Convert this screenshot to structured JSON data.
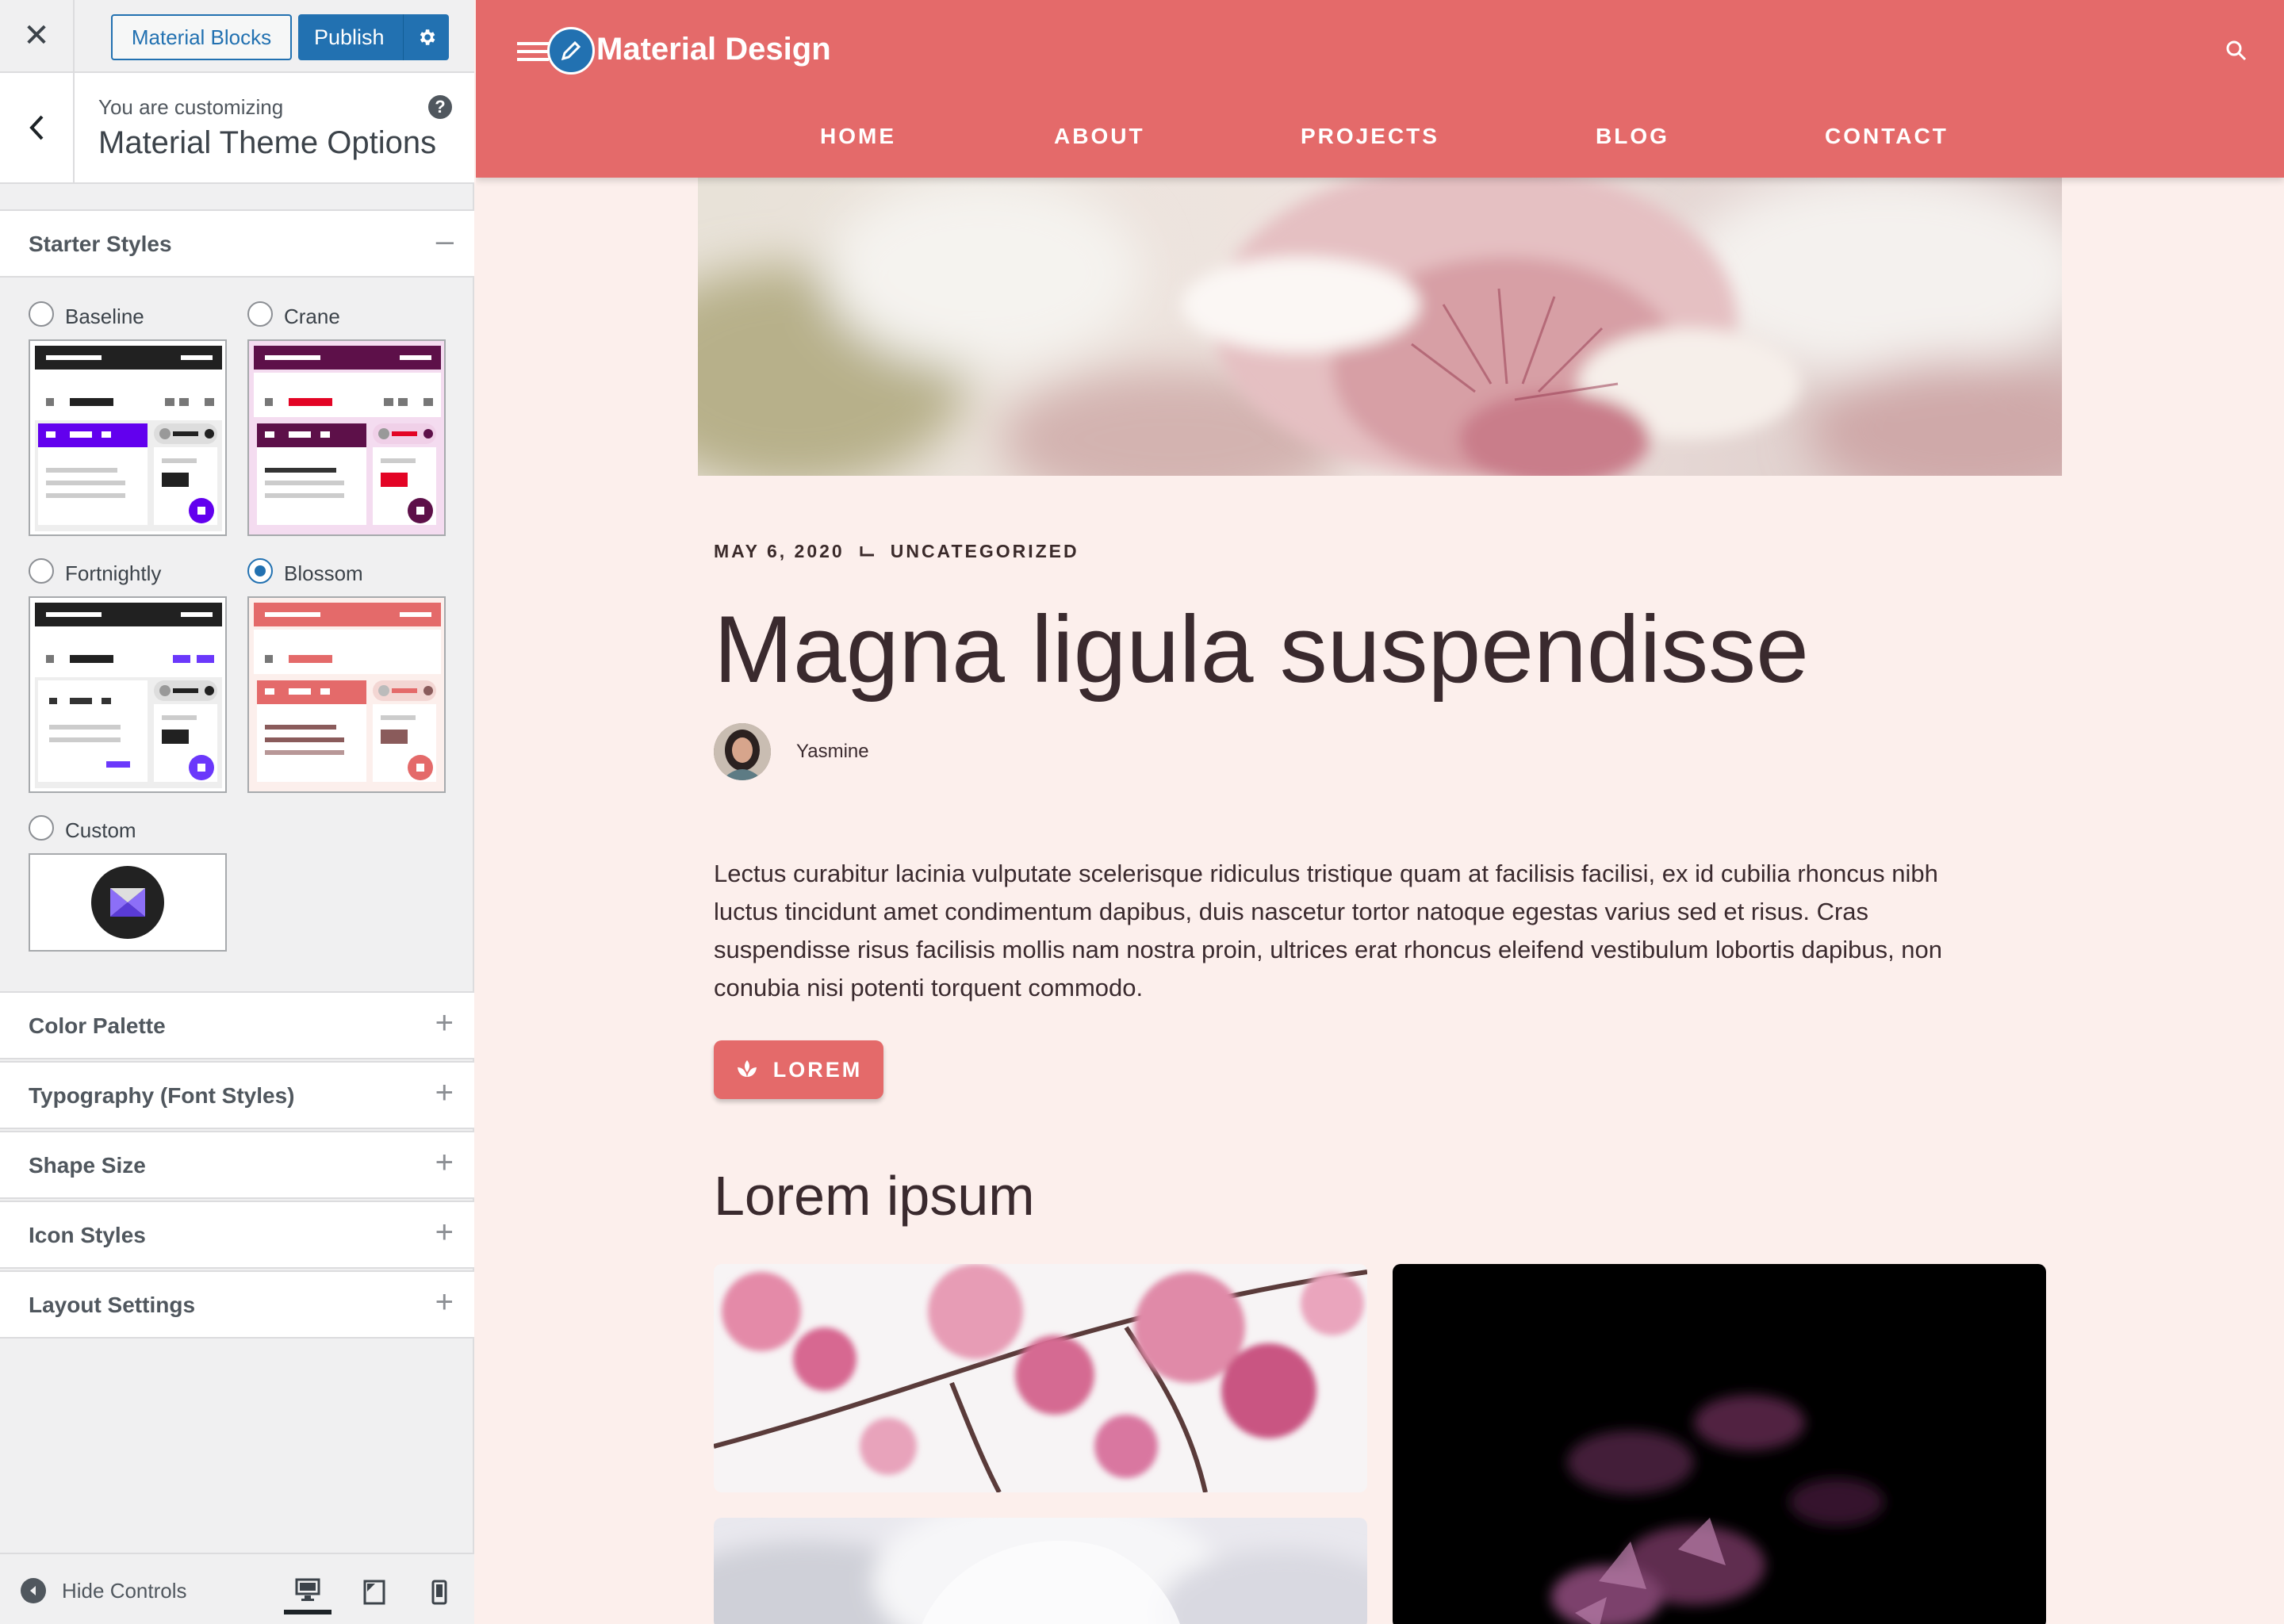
{
  "sidebar": {
    "topbar": {
      "material_blocks_label": "Material Blocks",
      "publish_label": "Publish"
    },
    "info": {
      "subtitle": "You are customizing",
      "title": "Material Theme Options"
    },
    "starter_styles": {
      "heading": "Starter Styles",
      "selected": "Blossom",
      "options": [
        {
          "label": "Baseline",
          "accent": "#6200ee"
        },
        {
          "label": "Crane",
          "accent": "#5d1049"
        },
        {
          "label": "Fortnightly",
          "accent": "#6b38fb"
        },
        {
          "label": "Blossom",
          "accent": "#e46a6a"
        },
        {
          "label": "Custom",
          "accent": "#222222"
        }
      ]
    },
    "sections": [
      {
        "label": "Color Palette"
      },
      {
        "label": "Typography (Font Styles)"
      },
      {
        "label": "Shape Size"
      },
      {
        "label": "Icon Styles"
      },
      {
        "label": "Layout Settings"
      }
    ],
    "footer": {
      "hide_controls_label": "Hide Controls",
      "active_device": "desktop"
    }
  },
  "preview": {
    "site_title": "Material Design",
    "nav": [
      "HOME",
      "ABOUT",
      "PROJECTS",
      "BLOG",
      "CONTACT"
    ],
    "post": {
      "date": "MAY 6, 2020",
      "category": "UNCATEGORIZED",
      "title": "Magna ligula suspendisse",
      "author": "Yasmine",
      "body": "Lectus curabitur lacinia vulputate scelerisque ridiculus tristique quam at facilisis facilisi, ex id cubilia rhoncus nibh luctus tincidunt amet condimentum dapibus, duis nascetur tortor natoque egestas varius sed et risus. Cras suspendisse risus facilisis mollis nam nostra proin, ultrices erat rhoncus eleifend vestibulum lobortis dapibus, non conubia nisi potenti torquent commodo.",
      "button_label": "LOREM",
      "subheading": "Lorem ipsum"
    },
    "colors": {
      "header": "#e46a6a",
      "background": "#fcefec",
      "text": "#3a2a2e"
    }
  }
}
